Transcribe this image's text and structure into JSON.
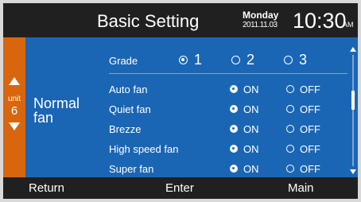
{
  "header": {
    "title": "Basic Setting",
    "day": "Monday",
    "date": "2011.11.03",
    "time": "10:30",
    "ampm": "AM"
  },
  "unit_panel": {
    "label": "unit",
    "number": "6",
    "up_icon": "triangle-up-icon",
    "down_icon": "triangle-down-icon",
    "color": "#d8660e"
  },
  "mode": {
    "line1": "Normal",
    "line2": "fan"
  },
  "grade": {
    "label": "Grade",
    "options": [
      "1",
      "2",
      "3"
    ],
    "selected": "1"
  },
  "fans": [
    {
      "label": "Auto fan",
      "on_label": "ON",
      "off_label": "OFF",
      "value": "ON"
    },
    {
      "label": "Quiet fan",
      "on_label": "ON",
      "off_label": "OFF",
      "value": "ON"
    },
    {
      "label": "Brezze",
      "on_label": "ON",
      "off_label": "OFF",
      "value": "ON"
    },
    {
      "label": "High speed fan",
      "on_label": "ON",
      "off_label": "OFF",
      "value": "ON"
    },
    {
      "label": "Super fan",
      "on_label": "ON",
      "off_label": "OFF",
      "value": "ON"
    }
  ],
  "footer": {
    "return_label": "Return",
    "enter_label": "Enter",
    "main_label": "Main"
  },
  "colors": {
    "accent": "#1a66b5",
    "panel": "#d8660e",
    "bar": "#202020"
  }
}
